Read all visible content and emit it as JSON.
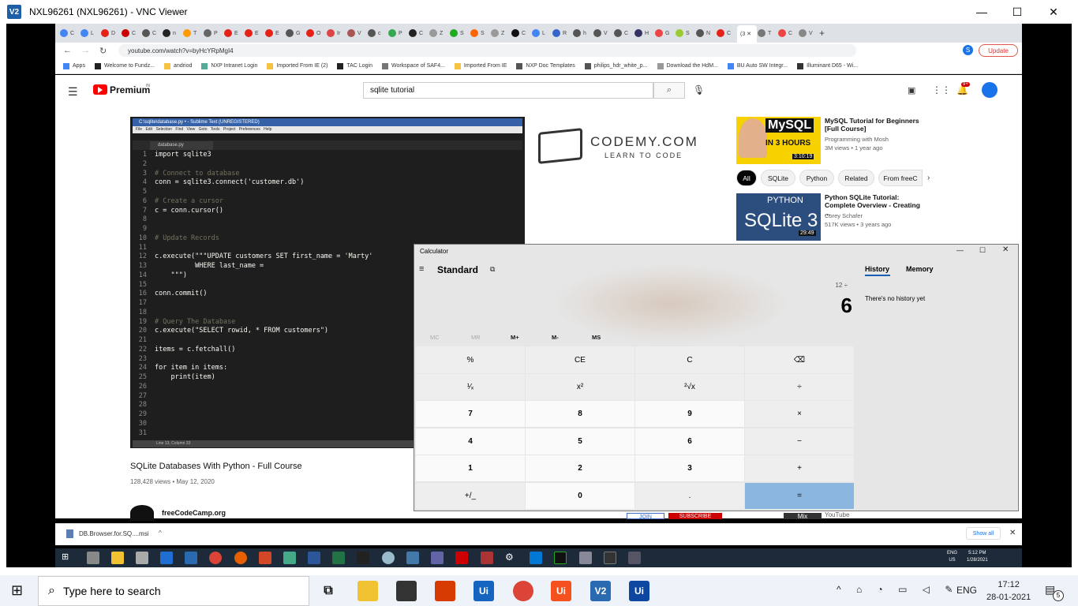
{
  "vnc": {
    "title": "NXL96261 (NXL96261) - VNC Viewer",
    "logo": "V2"
  },
  "browser": {
    "url": "youtube.com/watch?v=byHcYRpMgI4",
    "update_label": "Update",
    "profile_initial": "S",
    "bookmarks": [
      "Apps",
      "Welcome to Fundz...",
      "andriod",
      "NXP Intranet Login",
      "Imported From IE (2)",
      "TAC Login",
      "Workspace of SAF4...",
      "Imported From IE",
      "NXP Doc Templates",
      "philips_hdr_white_p...",
      "Download the HdM...",
      "BU Auto SW Integr...",
      "Illuminant D65 - Wi..."
    ],
    "active_tab_label": "(3"
  },
  "youtube": {
    "brand": "Premium",
    "region": "IN",
    "search_value": "sqlite tutorial",
    "notif_count": "9+",
    "video_title": "SQLite Databases With Python - Full Course",
    "video_meta": "128,428 views • May 12, 2020",
    "channel": "freeCodeCamp.org",
    "join": "JOIN",
    "subscribe": "SUBSCRIBE",
    "chips": [
      "All",
      "SQLite",
      "Python",
      "Related",
      "From freeC"
    ],
    "related": [
      {
        "title": "MySQL Tutorial for Beginners [Full Course]",
        "channel": "Programming with Mosh",
        "meta": "3M views • 1 year ago",
        "duration": "3:10:19",
        "thumb_text": "MySQL",
        "thumb_sub": "IN 3 HOURS"
      },
      {
        "title": "Python SQLite Tutorial: Complete Overview - Creating ...",
        "channel": "Corey Schafer",
        "meta": "517K views • 3 years ago",
        "duration": "29:49",
        "thumb_text": "SQLite 3",
        "thumb_sub": "PYTHON"
      }
    ],
    "bottom_right": "YouTube",
    "bottom_thumb": "Mix"
  },
  "sublime": {
    "title": "C:\\sqlite\\database.py • - Sublime Text (UNREGISTERED)",
    "menu": "File Edit Selection Find View Goto Tools Project Preferences Help",
    "tab": "database.py",
    "status": "Line 13, Column 33",
    "code": [
      "import sqlite3",
      "",
      "# Connect to database",
      "conn = sqlite3.connect('customer.db')",
      "",
      "# Create a cursor",
      "c = conn.cursor()",
      "",
      "",
      "# Update Records",
      "",
      "c.execute(\"\"\"UPDATE customers SET first_name = 'Marty'",
      "          WHERE last_name = ",
      "    \"\"\")",
      "",
      "conn.commit()",
      "",
      "",
      "# Query The Database",
      "c.execute(\"SELECT rowid, * FROM customers\")",
      "",
      "items = c.fetchall()",
      "",
      "for item in items:",
      "    print(item)",
      "",
      "",
      "",
      "",
      "",
      ""
    ],
    "codemy": "CODEMY.COM",
    "codemy_sub": "LEARN TO CODE"
  },
  "calculator": {
    "title": "Calculator",
    "mode": "Standard",
    "expression": "12 ÷",
    "display": "6",
    "memory_buttons": [
      "MC",
      "MR",
      "M+",
      "M-",
      "MS"
    ],
    "history_tab": "History",
    "memory_tab": "Memory",
    "history_empty": "There's no history yet",
    "keys": [
      [
        "%",
        "CE",
        "C",
        "⌫"
      ],
      [
        "¹⁄ₓ",
        "x²",
        "²√x",
        "÷"
      ],
      [
        "7",
        "8",
        "9",
        "×"
      ],
      [
        "4",
        "5",
        "6",
        "−"
      ],
      [
        "1",
        "2",
        "3",
        "+"
      ],
      [
        "+/_",
        "0",
        ".",
        "="
      ]
    ]
  },
  "downloads": {
    "file": "DB.Browser.for.SQ....msi",
    "show_all": "Show all"
  },
  "inner_taskbar": {
    "lang": "ENG",
    "region": "US",
    "time": "5:12 PM",
    "date": "1/28/2021"
  },
  "host_taskbar": {
    "search_placeholder": "Type here to search",
    "lang": "ENG",
    "time": "17:12",
    "date": "28-01-2021",
    "notif_count": "5",
    "ui_label": "Ui",
    "vnc_label": "V2"
  }
}
